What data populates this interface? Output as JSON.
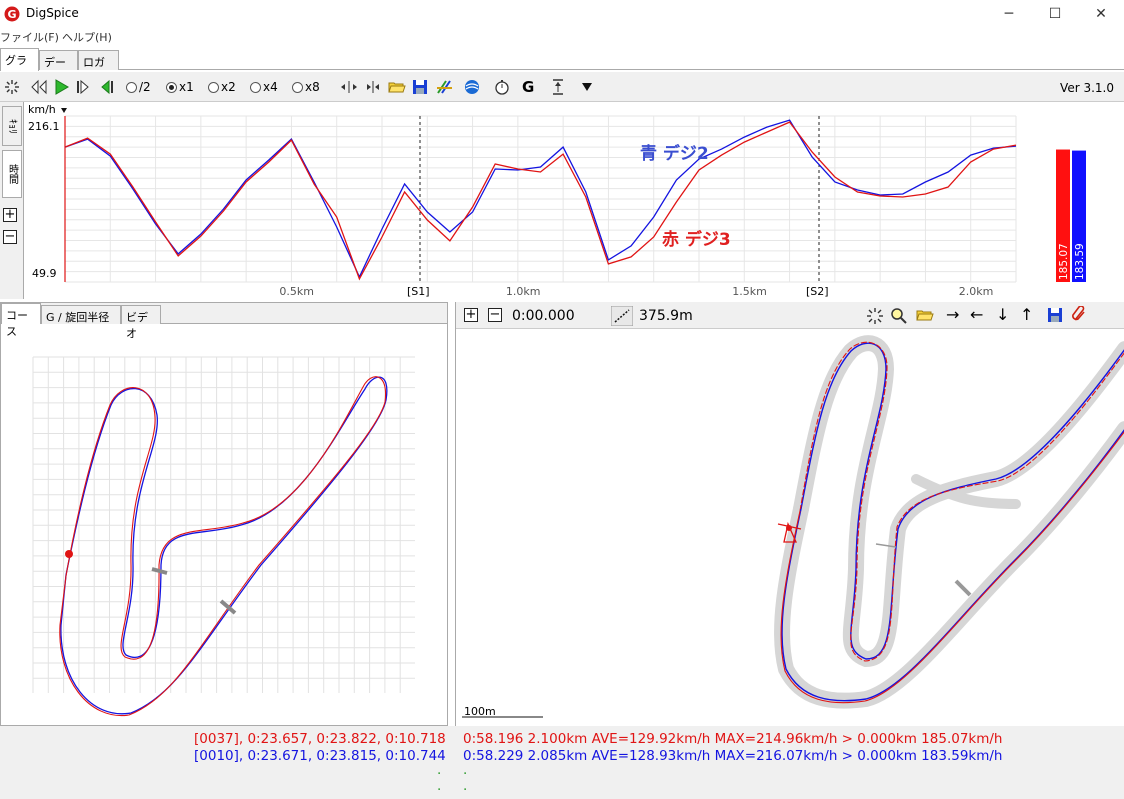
{
  "window": {
    "title": "DigSpice"
  },
  "menu": {
    "file": "ファイル(F)",
    "help": "ヘルプ(H)"
  },
  "tabs": {
    "graph": "グラフ",
    "data": "データ",
    "logger": "ロガー"
  },
  "toolbar": {
    "speed_half": "/2",
    "speed_x1": "x1",
    "speed_x2": "x2",
    "speed_x4": "x4",
    "speed_x8": "x8",
    "selected_speed": "x1",
    "g_label": "G",
    "version": "Ver 3.1.0"
  },
  "side_tabs": {
    "distance": "ｷｮﾘ",
    "time": "時間"
  },
  "graph": {
    "unit": "km/h",
    "y_max": "216.1",
    "y_min": "49.9",
    "x_ticks": [
      "0.5km",
      "1.0km",
      "1.5km",
      "2.0km"
    ],
    "sector_labels": [
      "[S1]",
      "[S2]"
    ],
    "legend_blue": "青 デジ2",
    "legend_red": "赤 デジ3",
    "bar_red": "185.07",
    "bar_blue": "183.59",
    "colors": {
      "red": "#e01414",
      "blue": "#1414e0"
    }
  },
  "chart_data": {
    "type": "line",
    "xlabel": "",
    "ylabel": "km/h",
    "ylim": [
      49.9,
      216.1
    ],
    "xlim": [
      0,
      2.1
    ],
    "x": [
      0.0,
      0.05,
      0.1,
      0.15,
      0.2,
      0.25,
      0.3,
      0.35,
      0.4,
      0.45,
      0.5,
      0.55,
      0.6,
      0.65,
      0.7,
      0.75,
      0.8,
      0.85,
      0.9,
      0.95,
      1.0,
      1.05,
      1.1,
      1.15,
      1.2,
      1.25,
      1.3,
      1.35,
      1.4,
      1.45,
      1.5,
      1.55,
      1.6,
      1.65,
      1.7,
      1.75,
      1.8,
      1.85,
      1.9,
      1.95,
      2.0,
      2.05,
      2.1
    ],
    "series": [
      {
        "name": "赤 デジ3",
        "values": [
          185,
          194,
          178,
          145,
          110,
          76,
          96,
          121,
          150,
          170,
          192,
          148,
          115,
          53,
          95,
          140,
          112,
          91,
          125,
          168,
          163,
          160,
          178,
          135,
          68,
          75,
          95,
          130,
          162,
          177,
          190,
          200,
          210,
          180,
          155,
          140,
          136,
          135,
          138,
          145,
          170,
          183,
          187
        ]
      },
      {
        "name": "青 デジ2",
        "values": [
          185,
          193,
          176,
          143,
          108,
          78,
          98,
          123,
          152,
          172,
          193,
          150,
          105,
          55,
          103,
          148,
          120,
          100,
          120,
          163,
          162,
          165,
          185,
          140,
          72,
          86,
          115,
          152,
          173,
          183,
          195,
          205,
          212,
          175,
          150,
          142,
          137,
          138,
          150,
          160,
          177,
          184,
          186
        ]
      }
    ]
  },
  "left_pane": {
    "tabs": {
      "course": "コース",
      "g_radius": "G / 旋回半径",
      "video": "ビデオ"
    }
  },
  "right_pane": {
    "time": "0:00.000",
    "distance": "375.9m",
    "scale_label": "100m"
  },
  "status": {
    "left_red": "[0037], 0:23.657, 0:23.822, 0:10.718",
    "left_blue": "[0010], 0:23.671, 0:23.815, 0:10.744",
    "right_red": "0:58.196 2.100km AVE=129.92km/h MAX=214.96km/h > 0.000km 185.07km/h",
    "right_blue": "0:58.229 2.085km AVE=128.93km/h MAX=216.07km/h > 0.000km 183.59km/h",
    "dot": "."
  }
}
